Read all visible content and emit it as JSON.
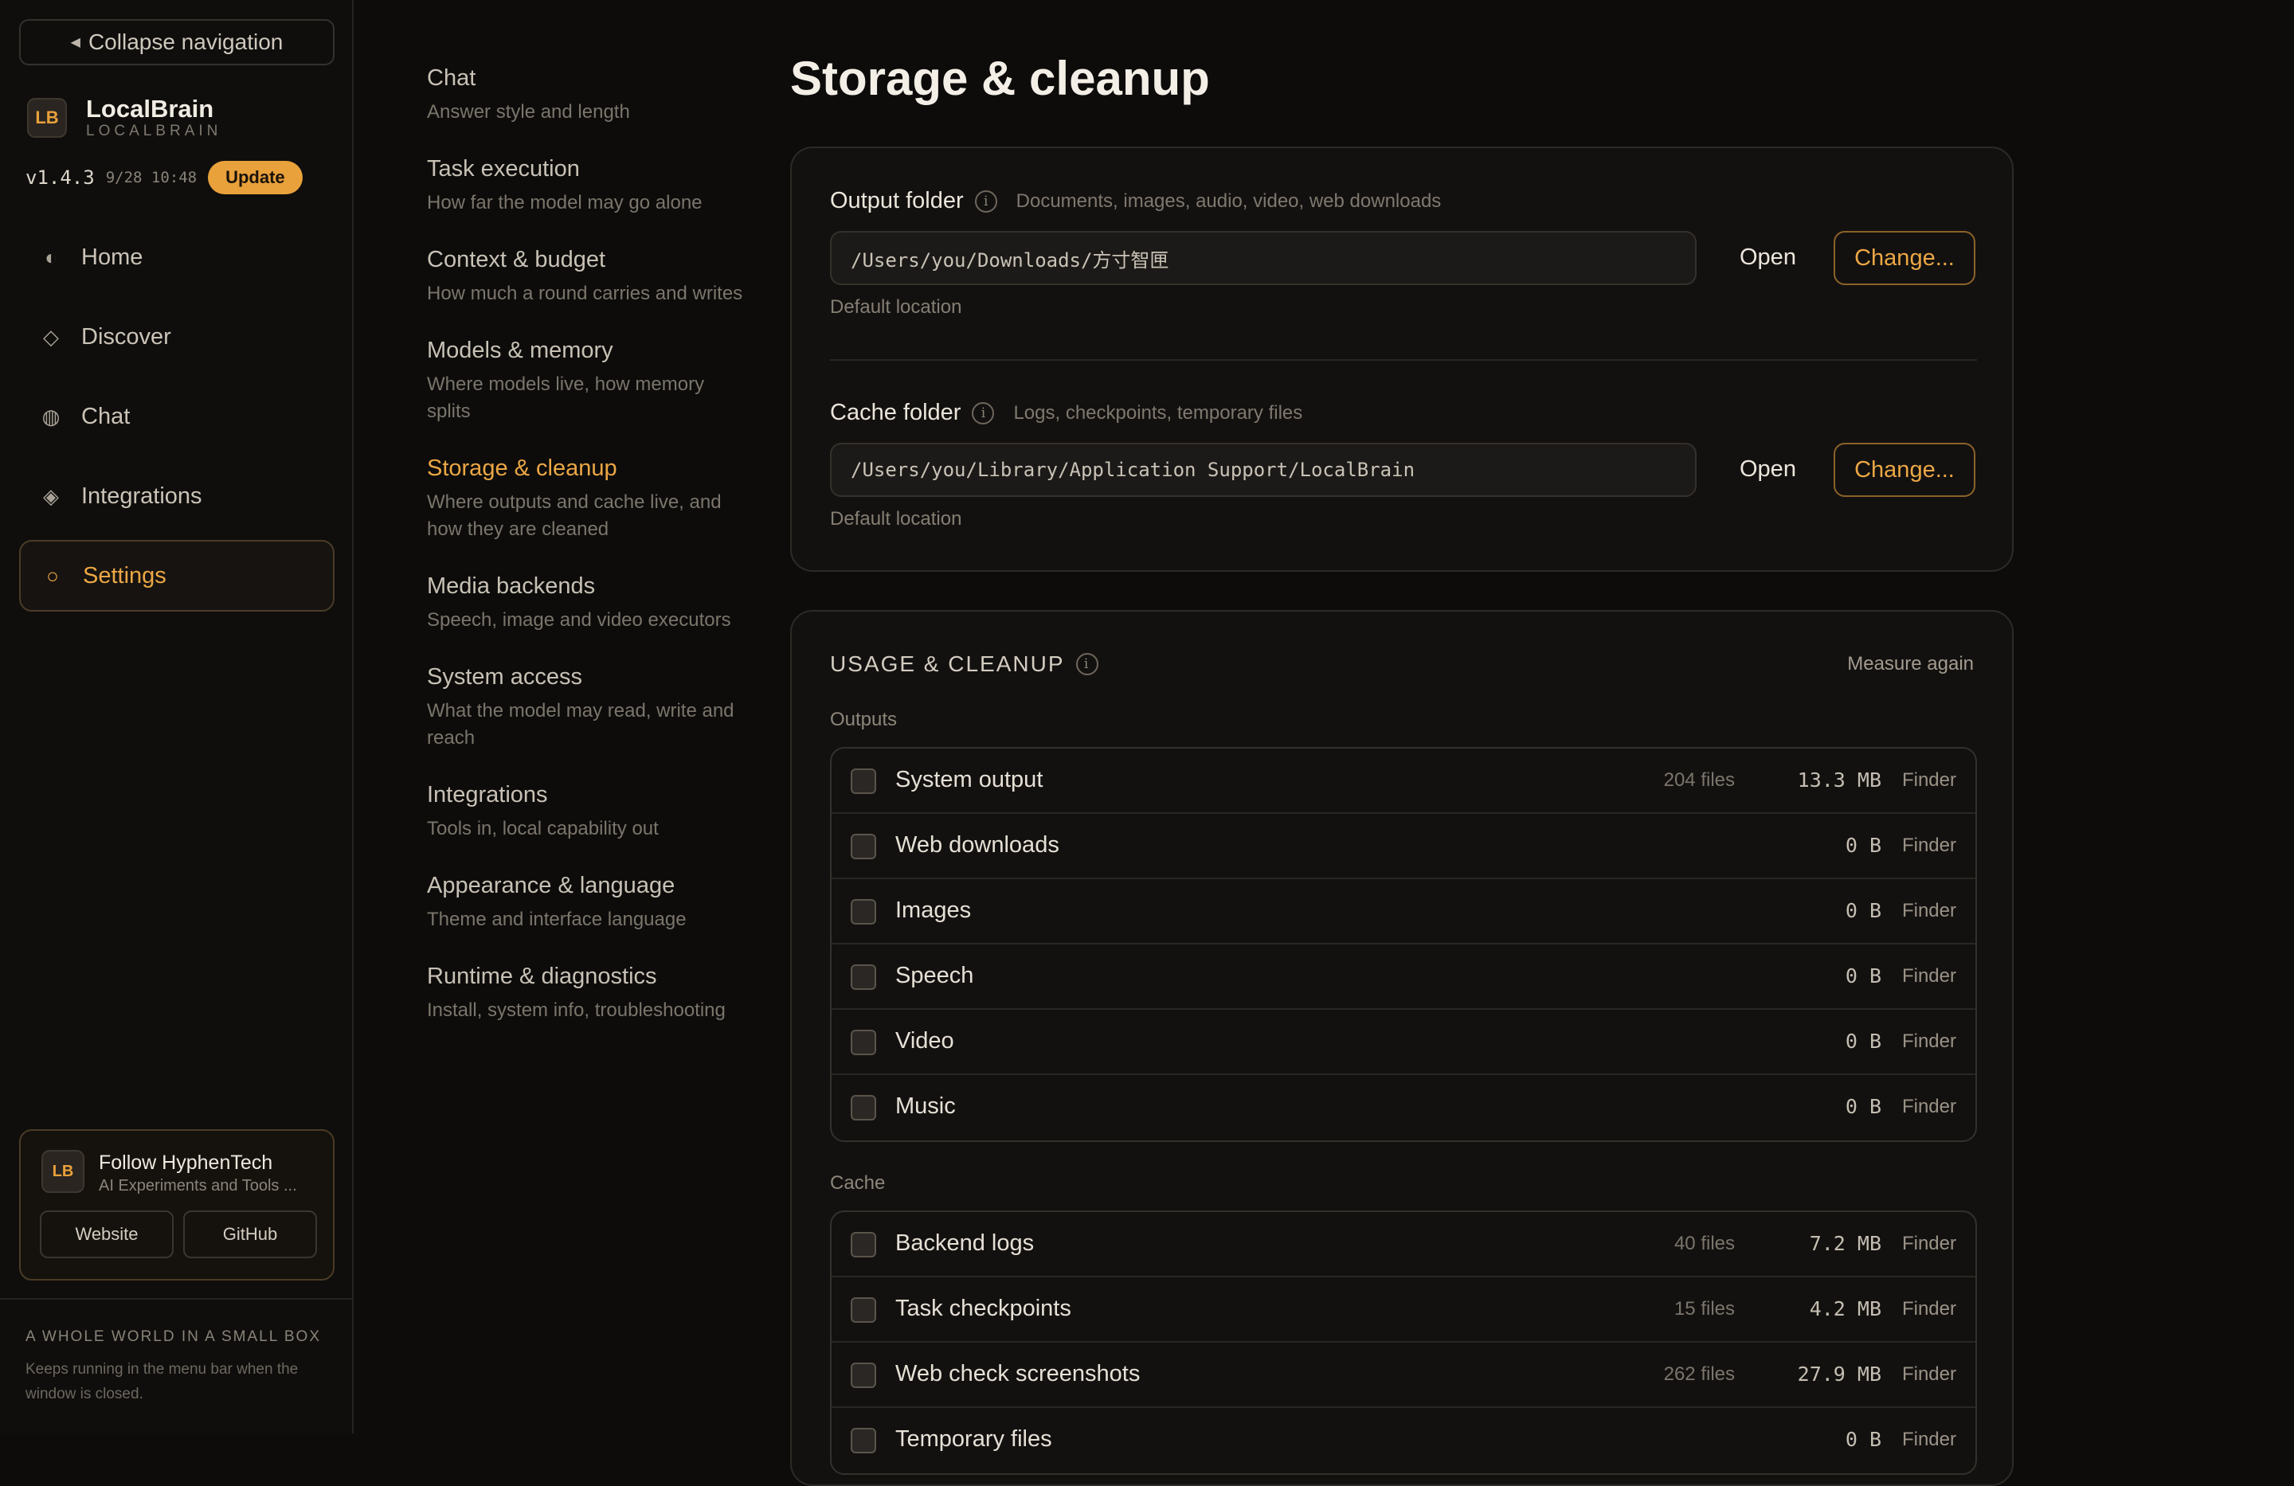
{
  "sidebar": {
    "collapse_label": "Collapse navigation",
    "brand_initials": "LB",
    "brand_name": "LocalBrain",
    "brand_sub": "LOCALBRAIN",
    "version": "v1.4.3",
    "build_time": "9/28 10:48",
    "update_label": "Update",
    "nav": [
      {
        "label": "Home",
        "icon": "◐",
        "icon_name": "home-icon"
      },
      {
        "label": "Discover",
        "icon": "◇",
        "icon_name": "discover-icon"
      },
      {
        "label": "Chat",
        "icon": "◍",
        "icon_name": "chat-icon"
      },
      {
        "label": "Integrations",
        "icon": "◈",
        "icon_name": "integrations-icon"
      },
      {
        "label": "Settings",
        "icon": "○",
        "icon_name": "settings-icon",
        "active": true
      }
    ],
    "follow": {
      "initials": "LB",
      "title": "Follow HyphenTech",
      "subtitle": "AI Experiments and Tools ...",
      "website_label": "Website",
      "github_label": "GitHub"
    },
    "tagline": "A WHOLE WORLD IN A SMALL BOX",
    "tagline_sub": "Keeps running in the menu bar when the window is closed."
  },
  "subnav": [
    {
      "title": "Chat",
      "desc": "Answer style and length"
    },
    {
      "title": "Task execution",
      "desc": "How far the model may go alone"
    },
    {
      "title": "Context & budget",
      "desc": "How much a round carries and writes"
    },
    {
      "title": "Models & memory",
      "desc": "Where models live, how memory splits"
    },
    {
      "title": "Storage & cleanup",
      "desc": "Where outputs and cache live, and how they are cleaned",
      "active": true
    },
    {
      "title": "Media backends",
      "desc": "Speech, image and video executors"
    },
    {
      "title": "System access",
      "desc": "What the model may read, write and reach"
    },
    {
      "title": "Integrations",
      "desc": "Tools in, local capability out"
    },
    {
      "title": "Appearance & language",
      "desc": "Theme and interface language"
    },
    {
      "title": "Runtime & diagnostics",
      "desc": "Install, system info, troubleshooting"
    }
  ],
  "main": {
    "title": "Storage & cleanup",
    "output_folder": {
      "label": "Output folder",
      "hint": "Documents, images, audio, video, web downloads",
      "path": "/Users/you/Downloads/方寸智匣",
      "open_label": "Open",
      "change_label": "Change...",
      "default_label": "Default location"
    },
    "cache_folder": {
      "label": "Cache folder",
      "hint": "Logs, checkpoints, temporary files",
      "path": "/Users/you/Library/Application Support/LocalBrain",
      "open_label": "Open",
      "change_label": "Change...",
      "default_label": "Default location"
    },
    "usage": {
      "title": "USAGE & CLEANUP",
      "measure_label": "Measure again",
      "outputs_label": "Outputs",
      "outputs": [
        {
          "name": "System output",
          "files": "204 files",
          "size": "13.3 MB",
          "finder": "Finder"
        },
        {
          "name": "Web downloads",
          "files": "",
          "size": "0 B",
          "finder": "Finder"
        },
        {
          "name": "Images",
          "files": "",
          "size": "0 B",
          "finder": "Finder"
        },
        {
          "name": "Speech",
          "files": "",
          "size": "0 B",
          "finder": "Finder"
        },
        {
          "name": "Video",
          "files": "",
          "size": "0 B",
          "finder": "Finder"
        },
        {
          "name": "Music",
          "files": "",
          "size": "0 B",
          "finder": "Finder"
        }
      ],
      "cache_label": "Cache",
      "cache": [
        {
          "name": "Backend logs",
          "files": "40 files",
          "size": "7.2 MB",
          "finder": "Finder"
        },
        {
          "name": "Task checkpoints",
          "files": "15 files",
          "size": "4.2 MB",
          "finder": "Finder"
        },
        {
          "name": "Web check screenshots",
          "files": "262 files",
          "size": "27.9 MB",
          "finder": "Finder"
        },
        {
          "name": "Temporary files",
          "files": "",
          "size": "0 B",
          "finder": "Finder"
        }
      ]
    }
  },
  "colors": {
    "accent": "#eba745",
    "background": "#0d0c0b"
  }
}
